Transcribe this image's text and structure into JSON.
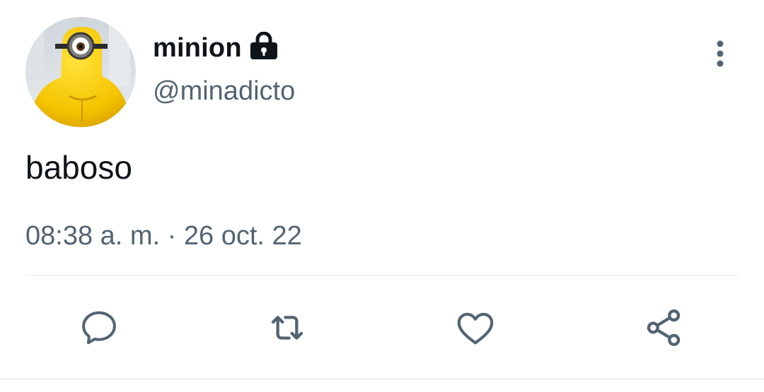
{
  "tweet": {
    "display_name": "minion",
    "handle": "@minadicto",
    "text": "baboso",
    "timestamp": "08:38 a. m. · 26 oct. 22",
    "protected": true
  },
  "icons": {
    "lock": "lock-icon",
    "more": "more-vertical-icon",
    "reply": "reply-icon",
    "retweet": "retweet-icon",
    "like": "heart-icon",
    "share": "share-icon"
  },
  "colors": {
    "text_primary": "#0f1419",
    "text_secondary": "#536471",
    "divider": "#eff3f4",
    "avatar_yellow": "#f5c400"
  }
}
